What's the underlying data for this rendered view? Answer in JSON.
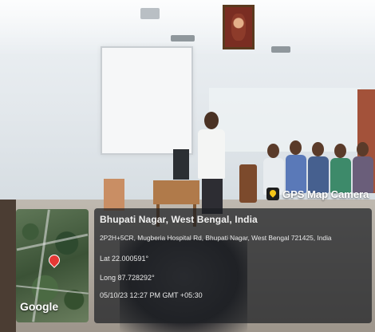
{
  "photo": {
    "description_free": true
  },
  "badge": {
    "label": "GPS Map Camera",
    "icon": "map-pin-icon"
  },
  "map": {
    "attribution": "Google",
    "pin_icon": "map-pin-icon"
  },
  "location": {
    "title": "Bhupati Nagar, West Bengal, India",
    "address": "2P2H+5CR, Mugberia Hospital Rd, Bhupati Nagar, West Bengal 721425, India",
    "latitude": "Lat 22.000591°",
    "longitude": "Long 87.728292°",
    "timestamp": "05/10/23 12:27 PM GMT +05:30"
  },
  "colors": {
    "overlay_bg": "#1c1e22",
    "badge_pin": "#f5c518",
    "map_pin": "#e53935"
  }
}
